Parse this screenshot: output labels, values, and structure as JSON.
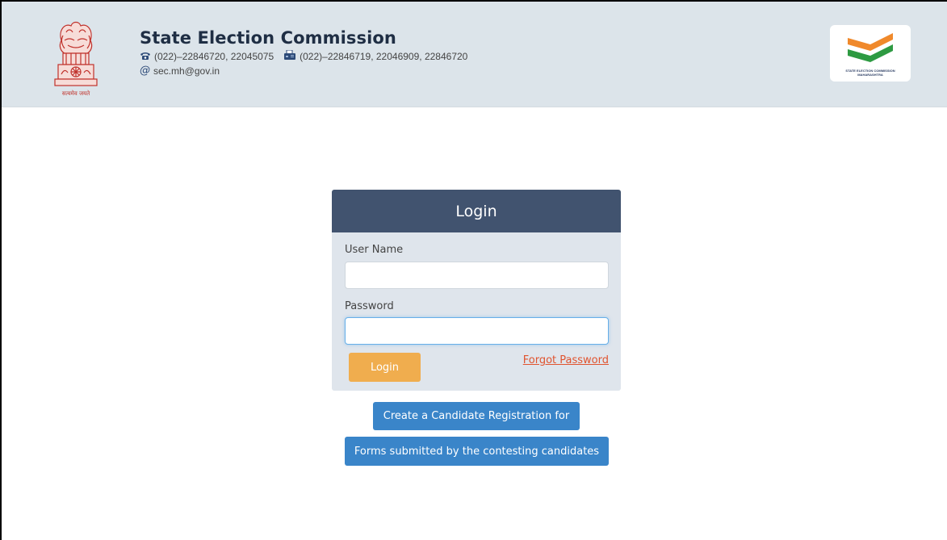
{
  "header": {
    "title": "State Election Commission",
    "phone": "(022)–22846720, 22045075",
    "fax": "(022)–22846719, 22046909, 22846720",
    "email": "sec.mh@gov.in",
    "emblem_caption": "सत्यमेव जयते",
    "logo_text_line1": "STATE ELECTION COMMISSION",
    "logo_text_line2": "MAHARASHTRA",
    "phone_icon": "telephone-icon",
    "fax_icon": "fax-icon",
    "email_icon": "at-sign-icon"
  },
  "login": {
    "heading": "Login",
    "username_label": "User Name",
    "username_value": "",
    "password_label": "Password",
    "password_value": "",
    "submit_label": "Login",
    "forgot_label": "Forgot Password"
  },
  "actions": {
    "create_registration_label": "Create a Candidate Registration for",
    "forms_submitted_label": "Forms submitted by the contesting candidates"
  },
  "colors": {
    "header_bg": "#dce4ea",
    "panel_head": "#41536f",
    "panel_body": "#dfe5ec",
    "login_button": "#f0ad4e",
    "link": "#e0542f",
    "action_button": "#3a85c9",
    "saffron": "#f0892b",
    "green": "#2e9a42"
  }
}
